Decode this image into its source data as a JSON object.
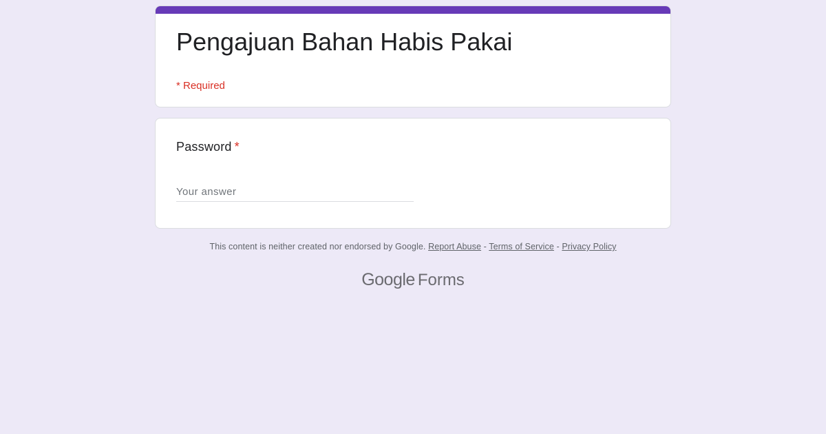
{
  "form": {
    "title": "Pengajuan Bahan Habis Pakai",
    "required_note": "* Required",
    "accent_color": "#673ab7"
  },
  "question": {
    "label": "Password",
    "asterisk": "*",
    "value": "",
    "placeholder": "Your answer"
  },
  "footer": {
    "disclaimer": "This content is neither created nor endorsed by Google.",
    "report_abuse": "Report Abuse",
    "separator": "-",
    "terms": "Terms of Service",
    "privacy": "Privacy Policy"
  },
  "brand": {
    "google": "Google",
    "forms": "Forms"
  }
}
